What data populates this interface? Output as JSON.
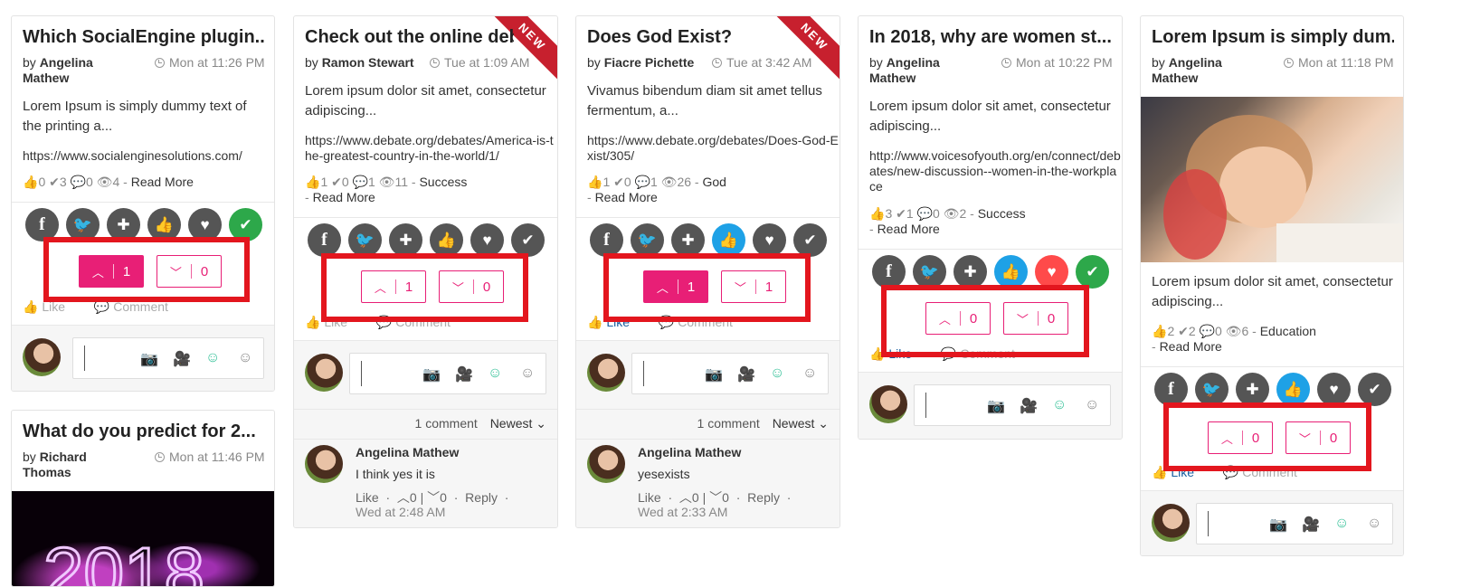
{
  "cards": [
    {
      "title": "Which SocialEngine plugin...",
      "by": "by",
      "author": "Angelina Mathew",
      "date": "Mon at 11:26 PM",
      "desc": "Lorem Ipsum is simply dummy text of the printing a...",
      "url": "https://www.socialenginesolutions.com/",
      "stats": {
        "likes": "0",
        "checks": "3",
        "comments": "0",
        "views": "4",
        "category": "",
        "read_more": "Read More"
      },
      "vote_up": "1",
      "vote_down": "0",
      "like_label": "Like",
      "comment_label": "Comment"
    },
    {
      "title": "Check out the online deba...",
      "badge": "NEW",
      "by": "by",
      "author": "Ramon Stewart",
      "date": "Tue at 1:09 AM",
      "desc": "Lorem ipsum dolor sit amet, consectetur adipiscing...",
      "url": "https://www.debate.org/debates/America-is-the-greatest-country-in-the-world/1/",
      "stats": {
        "likes": "1",
        "checks": "0",
        "comments": "1",
        "views": "11",
        "category": "Success",
        "read_more": "Read More"
      },
      "vote_up": "1",
      "vote_down": "0",
      "like_label": "Like",
      "comment_label": "Comment",
      "comment_count": "1 comment",
      "sort": "Newest",
      "comment": {
        "name": "Angelina Mathew",
        "text": "I think yes it is",
        "like": "Like",
        "up": "0",
        "down": "0",
        "reply": "Reply",
        "time": "Wed at 2:48 AM"
      }
    },
    {
      "title": "Does God Exist?",
      "badge": "NEW",
      "by": "by",
      "author": "Fiacre Pichette",
      "date": "Tue at 3:42 AM",
      "desc": "Vivamus bibendum diam sit amet tellus fermentum, a...",
      "url": "https://www.debate.org/debates/Does-God-Exist/305/",
      "stats": {
        "likes": "1",
        "checks": "0",
        "comments": "1",
        "views": "26",
        "category": "God",
        "read_more": "Read More"
      },
      "vote_up": "1",
      "vote_down": "1",
      "like_label": "Like",
      "comment_label": "Comment",
      "comment_count": "1 comment",
      "sort": "Newest",
      "comment": {
        "name": "Angelina Mathew",
        "text": "yesexists",
        "like": "Like",
        "up": "0",
        "down": "0",
        "reply": "Reply",
        "time": "Wed at 2:33 AM"
      }
    },
    {
      "title": "In 2018, why are women st...",
      "by": "by",
      "author": "Angelina Mathew",
      "date": "Mon at 10:22 PM",
      "desc": "Lorem ipsum dolor sit amet, consectetur adipiscing...",
      "url": "http://www.voicesofyouth.org/en/connect/debates/new-discussion--women-in-the-workplace",
      "stats": {
        "likes": "3",
        "checks": "1",
        "comments": "0",
        "views": "2",
        "category": "Success",
        "read_more": "Read More"
      },
      "vote_up": "0",
      "vote_down": "0",
      "like_label": "Like",
      "comment_label": "Comment"
    },
    {
      "title": "Lorem Ipsum is simply dum...",
      "by": "by",
      "author": "Angelina Mathew",
      "date": "Mon at 11:18 PM",
      "desc": "Lorem ipsum dolor sit amet, consectetur adipiscing...",
      "stats": {
        "likes": "2",
        "checks": "2",
        "comments": "0",
        "views": "6",
        "category": "Education",
        "read_more": "Read More"
      },
      "vote_up": "0",
      "vote_down": "0",
      "like_label": "Like",
      "comment_label": "Comment"
    },
    {
      "title": "What do you predict for 2...",
      "by": "by",
      "author": "Richard Thomas",
      "date": "Mon at 11:46 PM"
    }
  ],
  "colors": {
    "vote_accent": "#e81f76",
    "highlight_box": "#e3161e",
    "share_gray": "#555555",
    "share_green": "#2da84a",
    "share_blue": "#1ea1e6",
    "share_red": "#ff4a4a"
  }
}
